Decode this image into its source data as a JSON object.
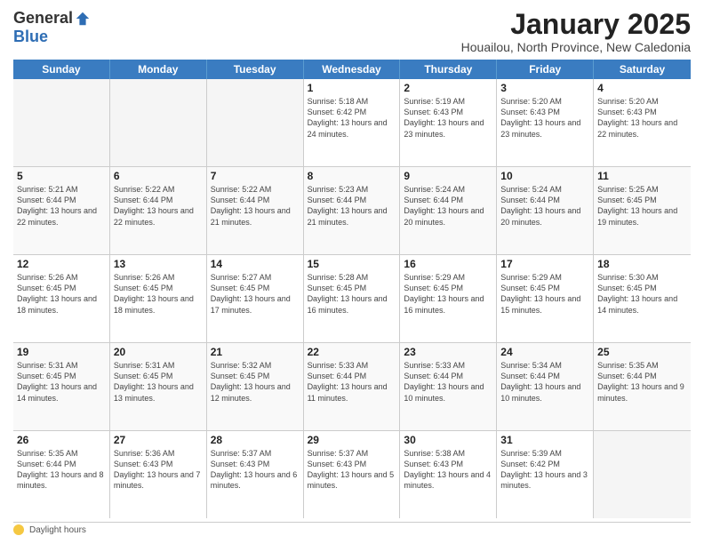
{
  "header": {
    "logo_general": "General",
    "logo_blue": "Blue",
    "main_title": "January 2025",
    "subtitle": "Houailou, North Province, New Caledonia"
  },
  "calendar": {
    "days_of_week": [
      "Sunday",
      "Monday",
      "Tuesday",
      "Wednesday",
      "Thursday",
      "Friday",
      "Saturday"
    ],
    "weeks": [
      [
        {
          "day": "",
          "info": "",
          "empty": true
        },
        {
          "day": "",
          "info": "",
          "empty": true
        },
        {
          "day": "",
          "info": "",
          "empty": true
        },
        {
          "day": "1",
          "info": "Sunrise: 5:18 AM\nSunset: 6:42 PM\nDaylight: 13 hours\nand 24 minutes."
        },
        {
          "day": "2",
          "info": "Sunrise: 5:19 AM\nSunset: 6:43 PM\nDaylight: 13 hours\nand 23 minutes."
        },
        {
          "day": "3",
          "info": "Sunrise: 5:20 AM\nSunset: 6:43 PM\nDaylight: 13 hours\nand 23 minutes."
        },
        {
          "day": "4",
          "info": "Sunrise: 5:20 AM\nSunset: 6:43 PM\nDaylight: 13 hours\nand 22 minutes."
        }
      ],
      [
        {
          "day": "5",
          "info": "Sunrise: 5:21 AM\nSunset: 6:44 PM\nDaylight: 13 hours\nand 22 minutes."
        },
        {
          "day": "6",
          "info": "Sunrise: 5:22 AM\nSunset: 6:44 PM\nDaylight: 13 hours\nand 22 minutes."
        },
        {
          "day": "7",
          "info": "Sunrise: 5:22 AM\nSunset: 6:44 PM\nDaylight: 13 hours\nand 21 minutes."
        },
        {
          "day": "8",
          "info": "Sunrise: 5:23 AM\nSunset: 6:44 PM\nDaylight: 13 hours\nand 21 minutes."
        },
        {
          "day": "9",
          "info": "Sunrise: 5:24 AM\nSunset: 6:44 PM\nDaylight: 13 hours\nand 20 minutes."
        },
        {
          "day": "10",
          "info": "Sunrise: 5:24 AM\nSunset: 6:44 PM\nDaylight: 13 hours\nand 20 minutes."
        },
        {
          "day": "11",
          "info": "Sunrise: 5:25 AM\nSunset: 6:45 PM\nDaylight: 13 hours\nand 19 minutes."
        }
      ],
      [
        {
          "day": "12",
          "info": "Sunrise: 5:26 AM\nSunset: 6:45 PM\nDaylight: 13 hours\nand 18 minutes."
        },
        {
          "day": "13",
          "info": "Sunrise: 5:26 AM\nSunset: 6:45 PM\nDaylight: 13 hours\nand 18 minutes."
        },
        {
          "day": "14",
          "info": "Sunrise: 5:27 AM\nSunset: 6:45 PM\nDaylight: 13 hours\nand 17 minutes."
        },
        {
          "day": "15",
          "info": "Sunrise: 5:28 AM\nSunset: 6:45 PM\nDaylight: 13 hours\nand 16 minutes."
        },
        {
          "day": "16",
          "info": "Sunrise: 5:29 AM\nSunset: 6:45 PM\nDaylight: 13 hours\nand 16 minutes."
        },
        {
          "day": "17",
          "info": "Sunrise: 5:29 AM\nSunset: 6:45 PM\nDaylight: 13 hours\nand 15 minutes."
        },
        {
          "day": "18",
          "info": "Sunrise: 5:30 AM\nSunset: 6:45 PM\nDaylight: 13 hours\nand 14 minutes."
        }
      ],
      [
        {
          "day": "19",
          "info": "Sunrise: 5:31 AM\nSunset: 6:45 PM\nDaylight: 13 hours\nand 14 minutes."
        },
        {
          "day": "20",
          "info": "Sunrise: 5:31 AM\nSunset: 6:45 PM\nDaylight: 13 hours\nand 13 minutes."
        },
        {
          "day": "21",
          "info": "Sunrise: 5:32 AM\nSunset: 6:45 PM\nDaylight: 13 hours\nand 12 minutes."
        },
        {
          "day": "22",
          "info": "Sunrise: 5:33 AM\nSunset: 6:44 PM\nDaylight: 13 hours\nand 11 minutes."
        },
        {
          "day": "23",
          "info": "Sunrise: 5:33 AM\nSunset: 6:44 PM\nDaylight: 13 hours\nand 10 minutes."
        },
        {
          "day": "24",
          "info": "Sunrise: 5:34 AM\nSunset: 6:44 PM\nDaylight: 13 hours\nand 10 minutes."
        },
        {
          "day": "25",
          "info": "Sunrise: 5:35 AM\nSunset: 6:44 PM\nDaylight: 13 hours\nand 9 minutes."
        }
      ],
      [
        {
          "day": "26",
          "info": "Sunrise: 5:35 AM\nSunset: 6:44 PM\nDaylight: 13 hours\nand 8 minutes."
        },
        {
          "day": "27",
          "info": "Sunrise: 5:36 AM\nSunset: 6:43 PM\nDaylight: 13 hours\nand 7 minutes."
        },
        {
          "day": "28",
          "info": "Sunrise: 5:37 AM\nSunset: 6:43 PM\nDaylight: 13 hours\nand 6 minutes."
        },
        {
          "day": "29",
          "info": "Sunrise: 5:37 AM\nSunset: 6:43 PM\nDaylight: 13 hours\nand 5 minutes."
        },
        {
          "day": "30",
          "info": "Sunrise: 5:38 AM\nSunset: 6:43 PM\nDaylight: 13 hours\nand 4 minutes."
        },
        {
          "day": "31",
          "info": "Sunrise: 5:39 AM\nSunset: 6:42 PM\nDaylight: 13 hours\nand 3 minutes."
        },
        {
          "day": "",
          "info": "",
          "empty": true
        }
      ]
    ]
  },
  "footer": {
    "daylight_label": "Daylight hours"
  }
}
